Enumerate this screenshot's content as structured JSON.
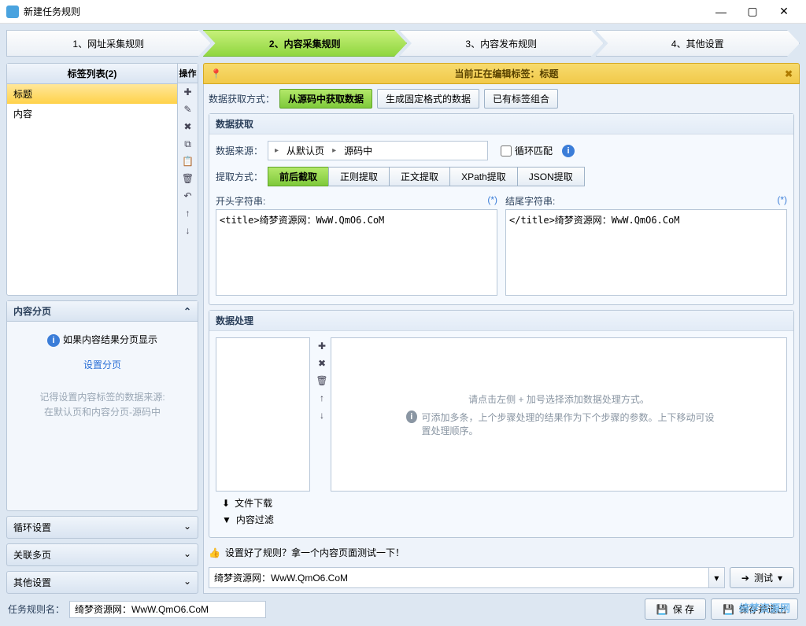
{
  "window": {
    "title": "新建任务规则"
  },
  "steps": [
    "1、网址采集规则",
    "2、内容采集规则",
    "3、内容发布规则",
    "4、其他设置"
  ],
  "active_step": 1,
  "taglist": {
    "header": "标签列表(2)",
    "ops_header": "操作",
    "items": [
      "标题",
      "内容"
    ],
    "selected": 0
  },
  "paging": {
    "header": "内容分页",
    "info": "如果内容结果分页显示",
    "link": "设置分页",
    "hint1": "记得设置内容标签的数据来源:",
    "hint2": "在默认页和内容分页-源码中"
  },
  "sections": [
    "循环设置",
    "关联多页",
    "其他设置"
  ],
  "editing": {
    "label": "当前正在编辑标签：标题"
  },
  "acquire": {
    "label": "数据获取方式：",
    "options": [
      "从源码中获取数据",
      "生成固定格式的数据",
      "已有标签组合"
    ],
    "active": 0
  },
  "datasource": {
    "group_title": "数据获取",
    "src_label": "数据来源：",
    "src_a": "从默认页",
    "src_b": "源码中",
    "loop_label": "循环匹配",
    "extract_label": "提取方式：",
    "tabs": [
      "前后截取",
      "正则提取",
      "正文提取",
      "XPath提取",
      "JSON提取"
    ],
    "active_tab": 0,
    "start_label": "开头字符串:",
    "end_label": "结尾字符串:",
    "star": "(*)",
    "start_val": "<title>绮梦资源网：WwW.QmO6.CoM",
    "end_val": "</title>绮梦资源网：WwW.QmO6.CoM"
  },
  "processing": {
    "group_title": "数据处理",
    "msg1": "请点击左侧 + 加号选择添加数据处理方式。",
    "msg2": "可添加多条，上个步骤处理的结果作为下个步骤的参数。上下移动可设置处理顺序。",
    "foot1": "文件下载",
    "foot2": "内容过滤"
  },
  "test": {
    "prompt": "设置好了规则？拿一个内容页面测试一下！",
    "value": "绮梦资源网：WwW.QmO6.CoM",
    "btn": "测试",
    "dd": "▾"
  },
  "footer": {
    "name_label": "任务规则名：",
    "name_value": "绮梦资源网：WwW.QmO6.CoM",
    "save": "保 存",
    "save_close": "保存并退出"
  },
  "watermark": "绮梦资源网"
}
